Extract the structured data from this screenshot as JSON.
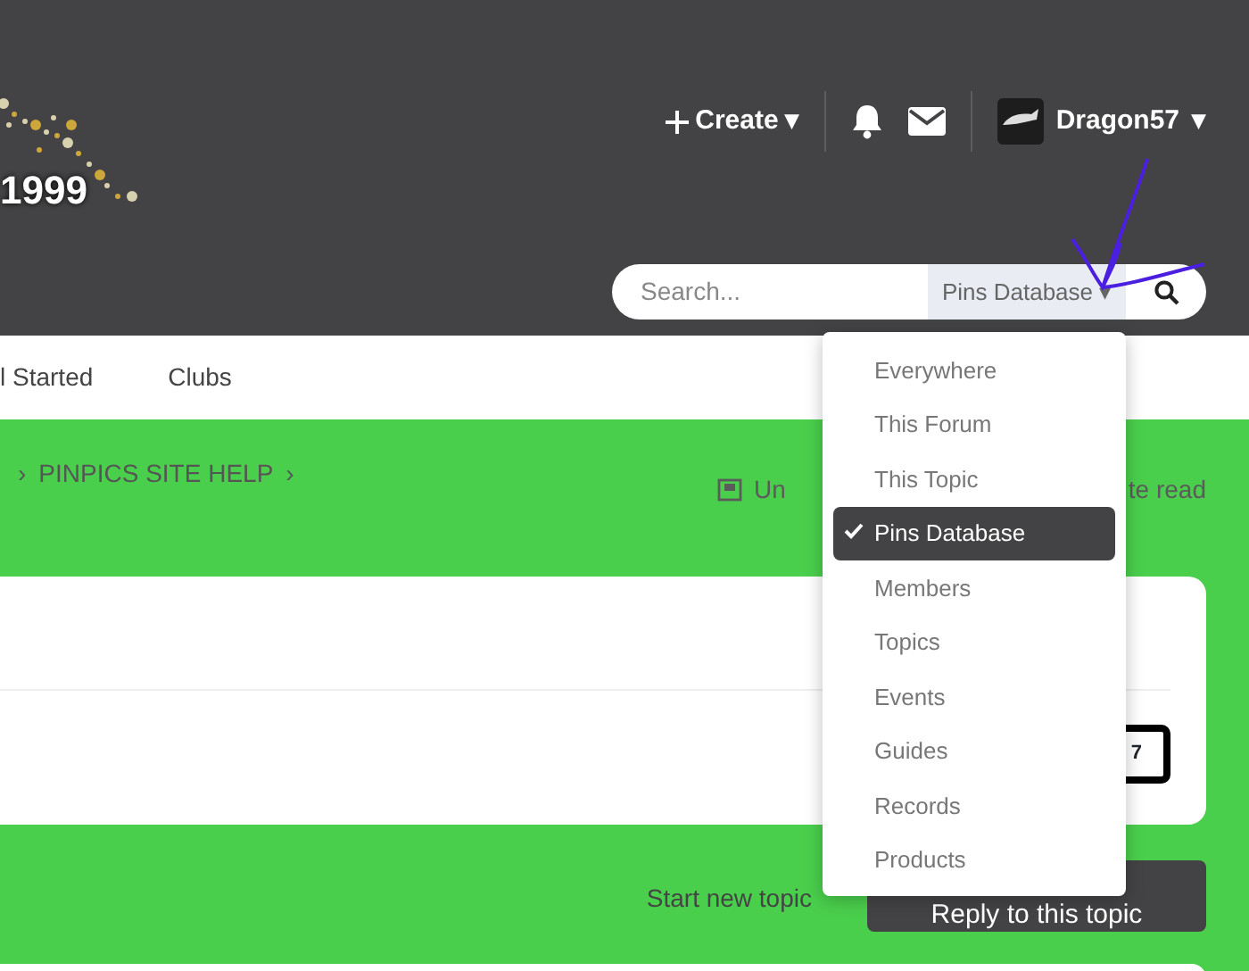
{
  "logo": {
    "text": "1999"
  },
  "user_bar": {
    "create": "Create",
    "caret": "▾",
    "username": "Dragon57",
    "user_caret": "▾"
  },
  "search": {
    "placeholder": "Search...",
    "scope": "Pins Database",
    "scope_caret": "▾"
  },
  "nav": [
    {
      "label": "l Started"
    },
    {
      "label": "Clubs"
    }
  ],
  "breadcrumb": {
    "sep": "›",
    "items": [
      "PINPICS SITE HELP"
    ]
  },
  "page_actions": {
    "left_part": "Un",
    "right_part": "te read"
  },
  "card": {
    "badge_text": "7"
  },
  "actions": {
    "start": "Start new topic",
    "reply": "Reply to this topic"
  },
  "scope_menu": [
    {
      "label": "Everywhere",
      "selected": false
    },
    {
      "label": "This Forum",
      "selected": false
    },
    {
      "label": "This Topic",
      "selected": false
    },
    {
      "label": "Pins Database",
      "selected": true
    },
    {
      "label": "Members",
      "selected": false
    },
    {
      "label": "Topics",
      "selected": false
    },
    {
      "label": "Events",
      "selected": false
    },
    {
      "label": "Guides",
      "selected": false
    },
    {
      "label": "Records",
      "selected": false
    },
    {
      "label": "Products",
      "selected": false
    }
  ]
}
